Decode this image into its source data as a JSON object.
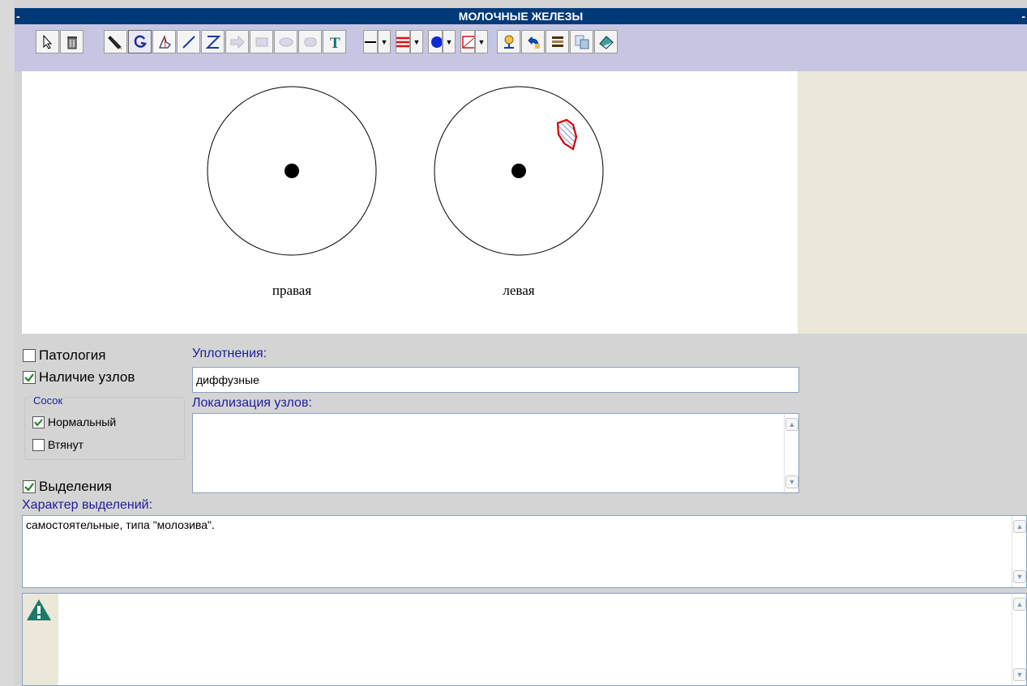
{
  "window": {
    "title": "МОЛОЧНЫЕ ЖЕЛЕЗЫ"
  },
  "toolbar": {
    "tools": [
      "select-arrow",
      "delete-trash",
      "pencil",
      "lasso",
      "hand",
      "line",
      "polyline",
      "arrow-shape",
      "rectangle",
      "ellipse",
      "rounded-rect",
      "text",
      "line-style",
      "line-width",
      "fill-color",
      "fill-pattern",
      "stamp",
      "undo",
      "properties",
      "copy",
      "eraser"
    ],
    "colors": {
      "line_width": "#e01010",
      "fill_color": "#0a2ad8",
      "fill_pattern": "#e01010"
    }
  },
  "diagram": {
    "right_label": "правая",
    "left_label": "левая",
    "lesion_color": "#d40000"
  },
  "form": {
    "pathology_label": "Патология",
    "pathology_checked": false,
    "nodes_label": "Наличие узлов",
    "nodes_checked": true,
    "nipple_group_title": "Сосок",
    "nipple_normal_label": "Нормальный",
    "nipple_normal_checked": true,
    "nipple_retracted_label": "Втянут",
    "nipple_retracted_checked": false,
    "discharge_label": "Выделения",
    "discharge_checked": true,
    "indurations_label": "Уплотнения:",
    "indurations_value": "диффузные",
    "nodes_location_label": "Локализация узлов:",
    "nodes_location_value": "",
    "discharge_character_label": "Характер выделений:",
    "discharge_character_value": "самостоятельные, типа \"молозива\".",
    "warning_text": ""
  }
}
